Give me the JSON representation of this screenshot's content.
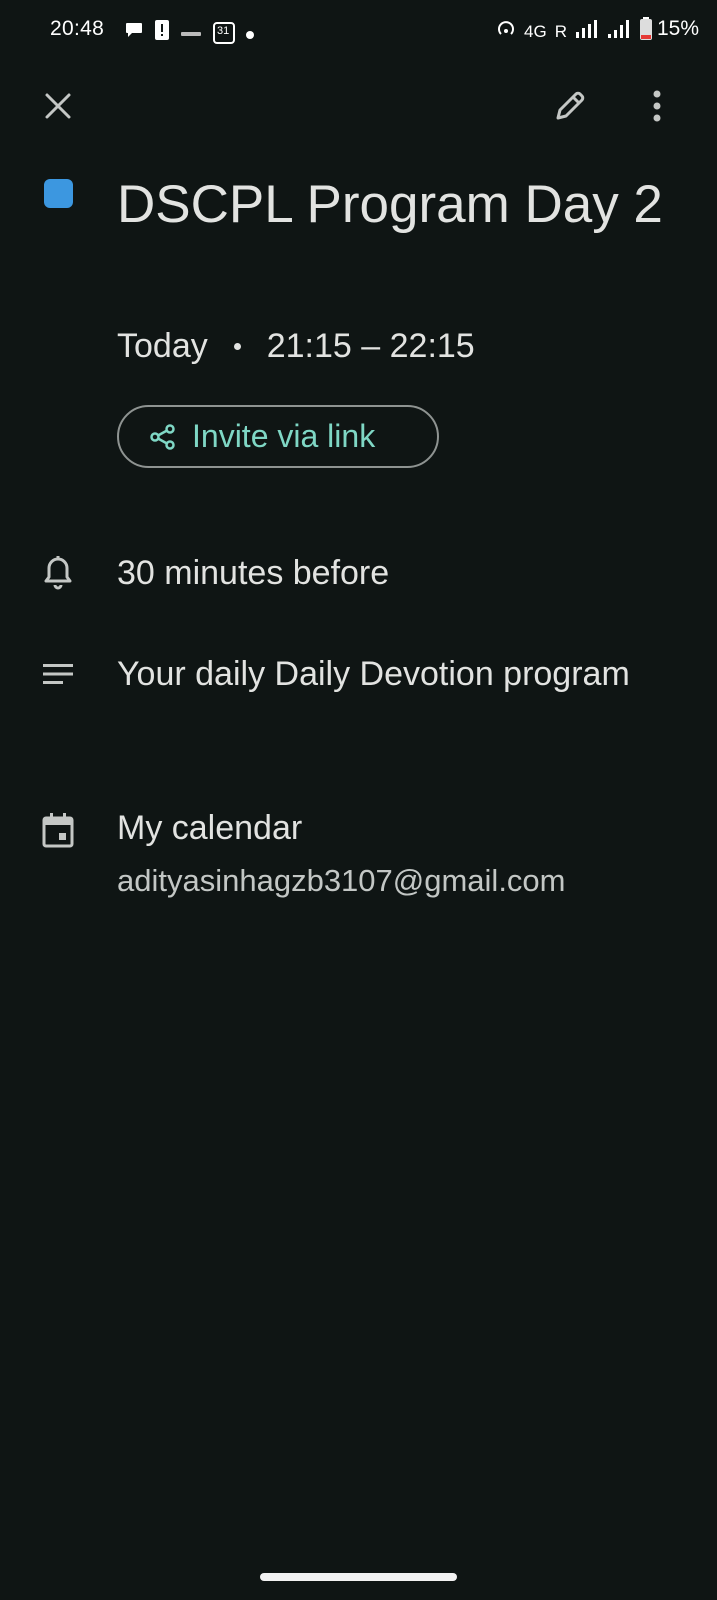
{
  "status_bar": {
    "time": "20:48",
    "calendar_day": "31",
    "network": "4G",
    "roaming": "R",
    "battery": "15%"
  },
  "toolbar": {
    "close_icon": "close-icon",
    "edit_icon": "pencil-icon",
    "more_icon": "more-vert-icon"
  },
  "event": {
    "color": "#3c97e0",
    "title": "DSCPL Program Day 2",
    "day": "Today",
    "time_range": "21:15 – 22:15",
    "invite_label": "Invite via link"
  },
  "details": {
    "reminder": "30 minutes before",
    "description": "Your daily Daily Devotion program",
    "calendar_name": "My calendar",
    "calendar_account": "adityasinhagzb3107@gmail.com"
  },
  "colors": {
    "background": "#0f1514",
    "accent": "#7fd7c5",
    "text": "#e2e3e1"
  }
}
